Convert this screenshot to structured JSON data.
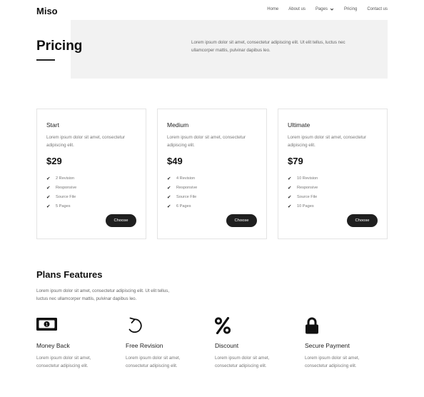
{
  "header": {
    "logo": "Miso",
    "nav": [
      {
        "label": "Home"
      },
      {
        "label": "About us"
      },
      {
        "label": "Pages"
      },
      {
        "label": "Pricing"
      },
      {
        "label": "Contact us"
      }
    ]
  },
  "hero": {
    "title": "Pricing",
    "text": "Lorem ipsum dolor sit amet, consectetur adipiscing elit. Ut elit tellus, luctus nec ullamcorper mattis, pulvinar dapibus leo."
  },
  "plans": [
    {
      "name": "Start",
      "desc": "Lorem ipsum dolor sit amet, consectetur adipiscing elit.",
      "price": "$29",
      "features": [
        "2 Revision",
        "Responsive",
        "Source File",
        "5 Pages"
      ],
      "button": "Choose"
    },
    {
      "name": "Medium",
      "desc": "Lorem ipsum dolor sit amet, consectetur adipiscing elit.",
      "price": "$49",
      "features": [
        "4 Revision",
        "Responsive",
        "Source File",
        "6 Pages"
      ],
      "button": "Choose"
    },
    {
      "name": "Ultimate",
      "desc": "Lorem ipsum dolor sit amet, consectetur adipiscing elit.",
      "price": "$79",
      "features": [
        "10 Revision",
        "Responsive",
        "Source File",
        "10 Pages"
      ],
      "button": "Choose"
    }
  ],
  "features_section": {
    "title": "Plans Features",
    "intro": "Lorem ipsum dolor sit amet, consectetur adipiscing elit. Ut elit tellus, luctus nec ullamcorper mattis, pulvinar dapibus leo.",
    "items": [
      {
        "icon": "money-bill-icon",
        "title": "Money Back",
        "desc": "Lorem ipsum dolor sit amet, consectetur adipiscing elit."
      },
      {
        "icon": "redo-icon",
        "title": "Free Revision",
        "desc": "Lorem ipsum dolor sit amet, consectetur adipiscing elit."
      },
      {
        "icon": "percent-icon",
        "title": "Discount",
        "desc": "Lorem ipsum dolor sit amet, consectetur adipiscing elit."
      },
      {
        "icon": "lock-icon",
        "title": "Secure Payment",
        "desc": "Lorem ipsum dolor sit amet, consectetur adipiscing elit."
      }
    ]
  }
}
